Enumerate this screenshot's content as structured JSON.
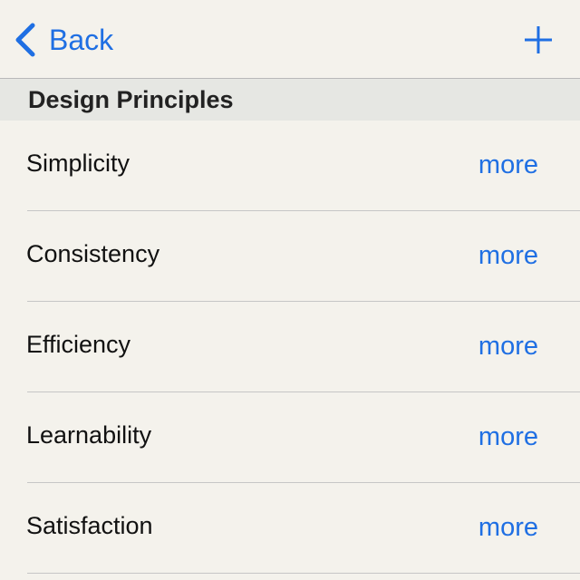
{
  "navbar": {
    "back_label": "Back",
    "back_icon": "chevron-left-icon",
    "add_icon": "plus-icon",
    "accent_color": "#1f6fe3"
  },
  "section": {
    "title": "Design Principles"
  },
  "rows": [
    {
      "title": "Simplicity",
      "action": "more"
    },
    {
      "title": "Consistency",
      "action": "more"
    },
    {
      "title": "Efficiency",
      "action": "more"
    },
    {
      "title": "Learnability",
      "action": "more"
    },
    {
      "title": "Satisfaction",
      "action": "more"
    }
  ]
}
